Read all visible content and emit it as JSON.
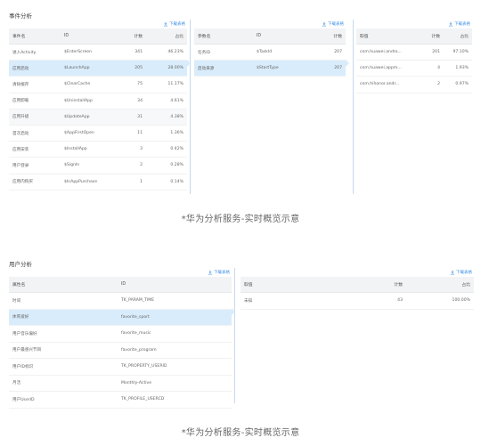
{
  "section1": {
    "title": "事件分析",
    "download_label": "下载表格",
    "events": {
      "columns": [
        "事件名",
        "ID",
        "计数",
        "占比"
      ],
      "rows": [
        {
          "name": "进入Activity",
          "id": "$EnterScreen",
          "count": "341",
          "pct": "46.23%"
        },
        {
          "name": "应用启动",
          "id": "$LaunchApp",
          "count": "205",
          "pct": "28.00%"
        },
        {
          "name": "清除缓存",
          "id": "$ClearCache",
          "count": "75",
          "pct": "11.17%"
        },
        {
          "name": "应用卸载",
          "id": "$UninstallApp",
          "count": "34",
          "pct": "4.61%"
        },
        {
          "name": "应用升级",
          "id": "$UpdateApp",
          "count": "31",
          "pct": "4.38%"
        },
        {
          "name": "首次启动",
          "id": "$AppFirstOpen",
          "count": "11",
          "pct": "1.36%"
        },
        {
          "name": "应用安装",
          "id": "$InstallApp",
          "count": "3",
          "pct": "0.42%"
        },
        {
          "name": "用户登录",
          "id": "$SignIn",
          "count": "2",
          "pct": "0.28%"
        },
        {
          "name": "应用内购买",
          "id": "$InAppPurchase",
          "count": "1",
          "pct": "0.14%"
        }
      ]
    },
    "params": {
      "columns": [
        "参数名",
        "ID",
        "计数"
      ],
      "rows": [
        {
          "name": "任务ID",
          "id": "$TaskId",
          "count": "207"
        },
        {
          "name": "启动来源",
          "id": "$StartType",
          "count": "207"
        }
      ]
    },
    "values": {
      "columns": [
        "取值",
        "计数",
        "占比"
      ],
      "rows": [
        {
          "value": "com.huawei.andro...",
          "count": "201",
          "pct": "97.10%"
        },
        {
          "value": "com.huawei.appm...",
          "count": "4",
          "pct": "1.93%"
        },
        {
          "value": "com.hihonor.andr...",
          "count": "2",
          "pct": "0.97%"
        }
      ]
    },
    "caption": "*华为分析服务-实时概览示意"
  },
  "section2": {
    "title": "用户分析",
    "download_label": "下载表格",
    "attrs": {
      "columns": [
        "属性名",
        "ID"
      ],
      "rows": [
        {
          "name": "时间",
          "id": "TK_PARAM_TIME"
        },
        {
          "name": "体育爱好",
          "id": "favorite_sport"
        },
        {
          "name": "用户音乐偏好",
          "id": "favorite_music"
        },
        {
          "name": "用户最感兴节目",
          "id": "favorite_program"
        },
        {
          "name": "用户ID标识",
          "id": "TK_PROPERTY_USERID"
        },
        {
          "name": "月活",
          "id": "Monthly-Active"
        },
        {
          "name": "用户UserID",
          "id": "TK_PROFILE_USERCD"
        }
      ]
    },
    "values": {
      "columns": [
        "取值",
        "计数",
        "占比"
      ],
      "rows": [
        {
          "value": "未知",
          "count": "43",
          "pct": "100.00%"
        }
      ]
    },
    "caption": "*华为分析服务-实时概览示意"
  },
  "colors": {
    "accent": "#3a8ee6",
    "selected_row": "#d9ecfb",
    "header_bg": "#f2f3f5"
  },
  "icons": {
    "download": "download-icon",
    "pointer": "triangle-pointer-icon"
  }
}
